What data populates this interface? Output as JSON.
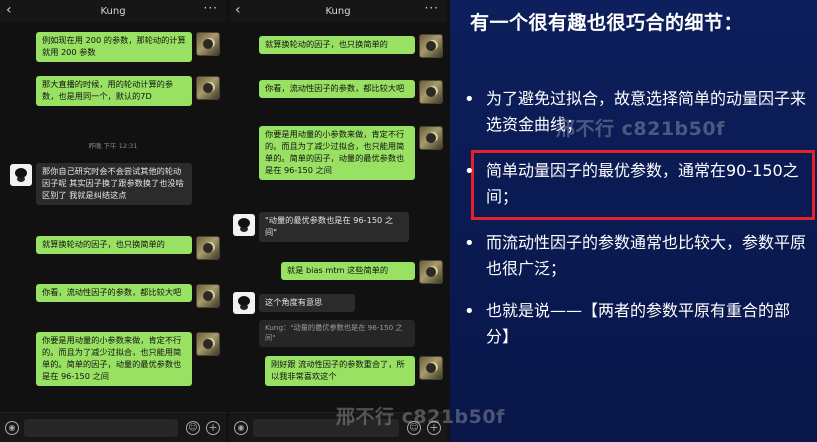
{
  "left_chat": {
    "title": "Kung",
    "messages": [
      {
        "text": "例如现在用 200 的参数，那轮动的计算就用 200 参数"
      },
      {
        "text": "那大直播的时候，用的轮动计算的参数，也是用同一个，默认的7D"
      },
      {
        "text": "那你自己研究时会不会尝试其他的轮动因子呢  其实因子换了跟参数换了也没啥区别了  我就是纠结这点"
      },
      {
        "text": "就算换轮动的因子，也只换简单的"
      },
      {
        "text": "你看，流动性因子的参数，都比较大吧"
      },
      {
        "text": "你要是用动量的小参数来做，肯定不行的。而且为了减少过拟合，也只能用简单的。简单的因子，动量的最优参数也是在 96-150 之间"
      }
    ],
    "timestamp": "昨晚 下午 12:31"
  },
  "right_chat": {
    "title": "Kung",
    "messages": [
      {
        "text": "就算换轮动的因子，也只换简单的"
      },
      {
        "text": "你看，流动性因子的参数，都比较大吧"
      },
      {
        "text": "你要是用动量的小参数来做，肯定不行的。而且为了减少过拟合，也只能用简单的。简单的因子，动量的最优参数也是在 96-150 之间"
      },
      {
        "text": "\"动量的最优参数也是在 96-150 之间\""
      },
      {
        "text": "就是 bias mtm 这些简单的"
      },
      {
        "text": "这个角度有意思"
      },
      {
        "text": "Kung：\"动量的最优参数也是在 96-150 之间\""
      },
      {
        "text": "刚好跟 流动性因子的参数重合了，所以我非常喜欢这个"
      }
    ]
  },
  "slide": {
    "title": "有一个很有趣也很巧合的细节：",
    "bullets": [
      {
        "text": "为了避免过拟合，故意选择简单的动量因子来选资金曲线；"
      },
      {
        "text": "简单动量因子的最优参数，通常在90-150之间；"
      },
      {
        "text": "而流动性因子的参数通常也比较大，参数平原也很广泛；"
      },
      {
        "text": "也就是说——【两者的参数平原有重合的部分】"
      }
    ]
  },
  "watermarks": {
    "top": "邢不行 c821b50f",
    "bottom": "邢不行 c821b50f"
  },
  "colors": {
    "green_bubble": "#98e163",
    "gray_bubble": "#2b2b2b",
    "slide_bg": "#0a1a52",
    "highlight": "#e0242a"
  },
  "icons": [
    "back-icon",
    "more-icon",
    "voice-icon",
    "emoji-icon",
    "plus-icon"
  ]
}
